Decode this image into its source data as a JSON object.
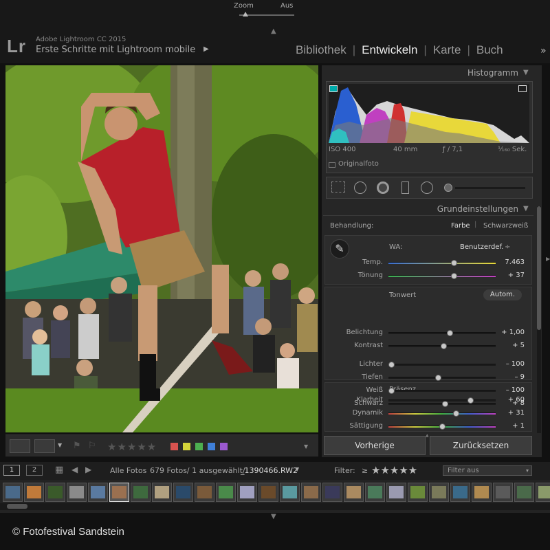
{
  "header": {
    "logo": "Lr",
    "app_version": "Adobe Lightroom CC 2015",
    "catalog_name": "Erste Schritte mit Lightroom mobile",
    "modules": [
      {
        "label": "Bibliothek",
        "active": false
      },
      {
        "label": "Entwickeln",
        "active": true
      },
      {
        "label": "Karte",
        "active": false
      },
      {
        "label": "Buch",
        "active": false
      }
    ],
    "more_modules": "»"
  },
  "histogram": {
    "title": "Histogramm",
    "iso": "ISO 400",
    "focal": "40 mm",
    "aperture": "ƒ / 7,1",
    "shutter": "¹⁄₁₆₀ Sek.",
    "original_label": "Originalfoto"
  },
  "basic": {
    "title": "Grundeinstellungen",
    "treatment_label": "Behandlung:",
    "treatment_color": "Farbe",
    "treatment_bw": "Schwarzweiß",
    "wb_label": "WA:",
    "wb_value": "Benutzerdef.",
    "wb_arrows": "÷",
    "tone_label": "Tonwert",
    "auto_label": "Autom.",
    "presence_label": "Präsenz",
    "sliders": [
      {
        "name": "Temp.",
        "value": "7.463",
        "level": 0.62
      },
      {
        "name": "Tönung",
        "value": "+ 37",
        "level": 0.62
      },
      {
        "name": "Belichtung",
        "value": "+ 1,00",
        "level": 0.58
      },
      {
        "name": "Kontrast",
        "value": "+ 5",
        "level": 0.52
      },
      {
        "name": "Lichter",
        "value": "– 100",
        "level": 0.0
      },
      {
        "name": "Tiefen",
        "value": "– 9",
        "level": 0.46
      },
      {
        "name": "Weiß",
        "value": "– 100",
        "level": 0.0
      },
      {
        "name": "Schwarz",
        "value": "+ 8",
        "level": 0.53
      },
      {
        "name": "Klarheit",
        "value": "+ 60",
        "level": 0.78
      },
      {
        "name": "Dynamik",
        "value": "+ 31",
        "level": 0.64
      },
      {
        "name": "Sättigung",
        "value": "+ 1",
        "level": 0.5
      }
    ]
  },
  "buttons": {
    "previous": "Vorherige",
    "reset": "Zurücksetzen"
  },
  "toolbar": {
    "stars": "★★★★★",
    "zoom_label": "Zoom",
    "zoom_value": "Aus"
  },
  "filmbar": {
    "screen1": "1",
    "screen2": "2",
    "source": "Alle Fotos",
    "count": "679 Fotos/ 1 ausgewählt/",
    "filename": "_1390466.RW2",
    "filter_label": "Filter:",
    "filter_op": "≥",
    "filter_stars": "★★★★★",
    "filter_value": "Filter aus"
  },
  "copyright": "© Fotofestival Sandstein",
  "colors": {
    "label_red": "#d9534f",
    "label_yellow": "#d4d43a",
    "label_green": "#4caf50",
    "label_blue": "#3f7fd8",
    "label_purple": "#9b59d0"
  }
}
